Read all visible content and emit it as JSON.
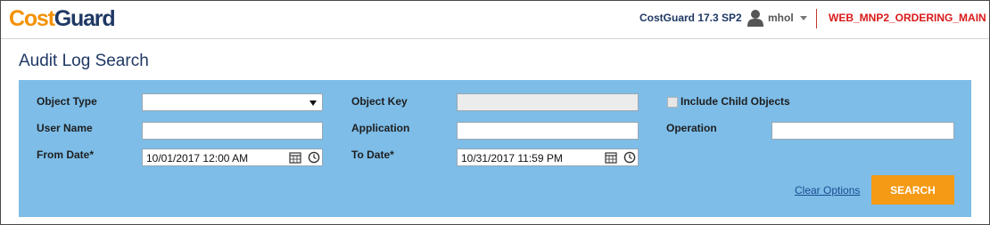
{
  "header": {
    "logo_part1": "Cost",
    "logo_part2": "Guard",
    "version": "CostGuard 17.3 SP2",
    "username": "mhol",
    "environment": "WEB_MNP2_ORDERING_MAIN"
  },
  "page": {
    "title": "Audit Log Search"
  },
  "form": {
    "object_type": {
      "label": "Object Type",
      "value": ""
    },
    "object_key": {
      "label": "Object Key",
      "value": ""
    },
    "include_child": {
      "label": "Include Child Objects",
      "checked": false
    },
    "user_name": {
      "label": "User Name",
      "value": ""
    },
    "application": {
      "label": "Application",
      "value": ""
    },
    "operation": {
      "label": "Operation",
      "value": ""
    },
    "from_date": {
      "label": "From Date*",
      "value": "10/01/2017 12:00 AM"
    },
    "to_date": {
      "label": "To Date*",
      "value": "10/31/2017 11:59 PM"
    }
  },
  "actions": {
    "clear_label": "Clear Options",
    "search_label": "SEARCH"
  },
  "colors": {
    "brand_orange": "#f39200",
    "brand_navy": "#1f3864",
    "panel_blue": "#7dbde8",
    "env_red": "#d91a1a",
    "search_button": "#f59a14"
  }
}
